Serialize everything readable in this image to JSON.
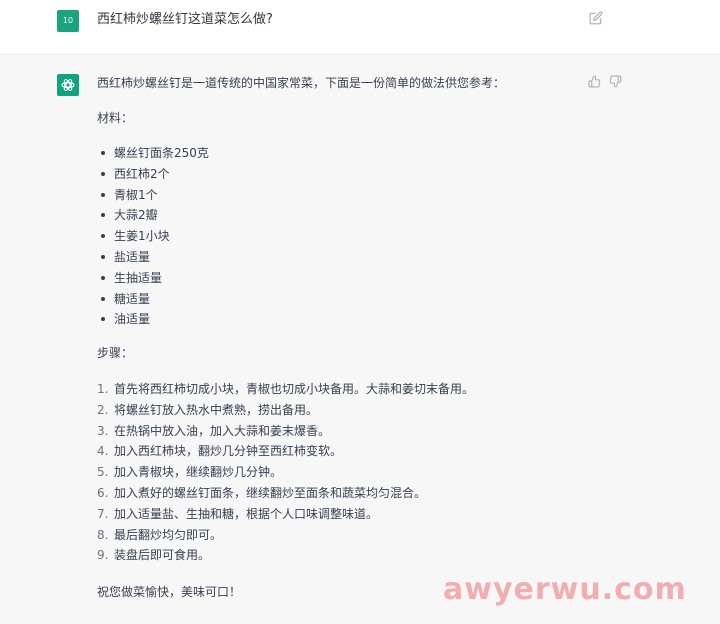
{
  "user_message": {
    "avatar_text": "10",
    "text": "西红柿炒螺丝钉这道菜怎么做?"
  },
  "assistant_message": {
    "intro": "西红柿炒螺丝钉是一道传统的中国家常菜，下面是一份简单的做法供您参考：",
    "materials_title": "材料：",
    "materials": [
      "螺丝钉面条250克",
      "西红柿2个",
      "青椒1个",
      "大蒜2瓣",
      "生姜1小块",
      "盐适量",
      "生抽适量",
      "糖适量",
      "油适量"
    ],
    "steps_title": "步骤：",
    "steps": [
      {
        "num": "1.",
        "text": "首先将西红柿切成小块，青椒也切成小块备用。大蒜和姜切末备用。"
      },
      {
        "num": "2.",
        "text": "将螺丝钉放入热水中煮熟，捞出备用。"
      },
      {
        "num": "3.",
        "text": "在热锅中放入油，加入大蒜和姜末爆香。"
      },
      {
        "num": "4.",
        "text": "加入西红柿块，翻炒几分钟至西红柿变软。"
      },
      {
        "num": "5.",
        "text": "加入青椒块，继续翻炒几分钟。"
      },
      {
        "num": "6.",
        "text": "加入煮好的螺丝钉面条，继续翻炒至面条和蔬菜均匀混合。"
      },
      {
        "num": "7.",
        "text": "加入适量盐、生抽和糖，根据个人口味调整味道。"
      },
      {
        "num": "8.",
        "text": "最后翻炒均匀即可。"
      },
      {
        "num": "9.",
        "text": "装盘后即可食用。"
      }
    ],
    "closing": "祝您做菜愉快，美味可口！"
  },
  "icons": {
    "edit": "pencil-square-icon",
    "bot_logo": "openai-logo-icon",
    "thumb_up": "thumb-up-icon",
    "thumb_down": "thumb-down-icon"
  },
  "colors": {
    "user_avatar": "#19a37f",
    "bot_avatar": "#10a37f",
    "assistant_bg": "#f7f7f8",
    "user_bg": "#ffffff",
    "watermark": "#f2a6a6"
  },
  "watermark": "awyerwu.com"
}
